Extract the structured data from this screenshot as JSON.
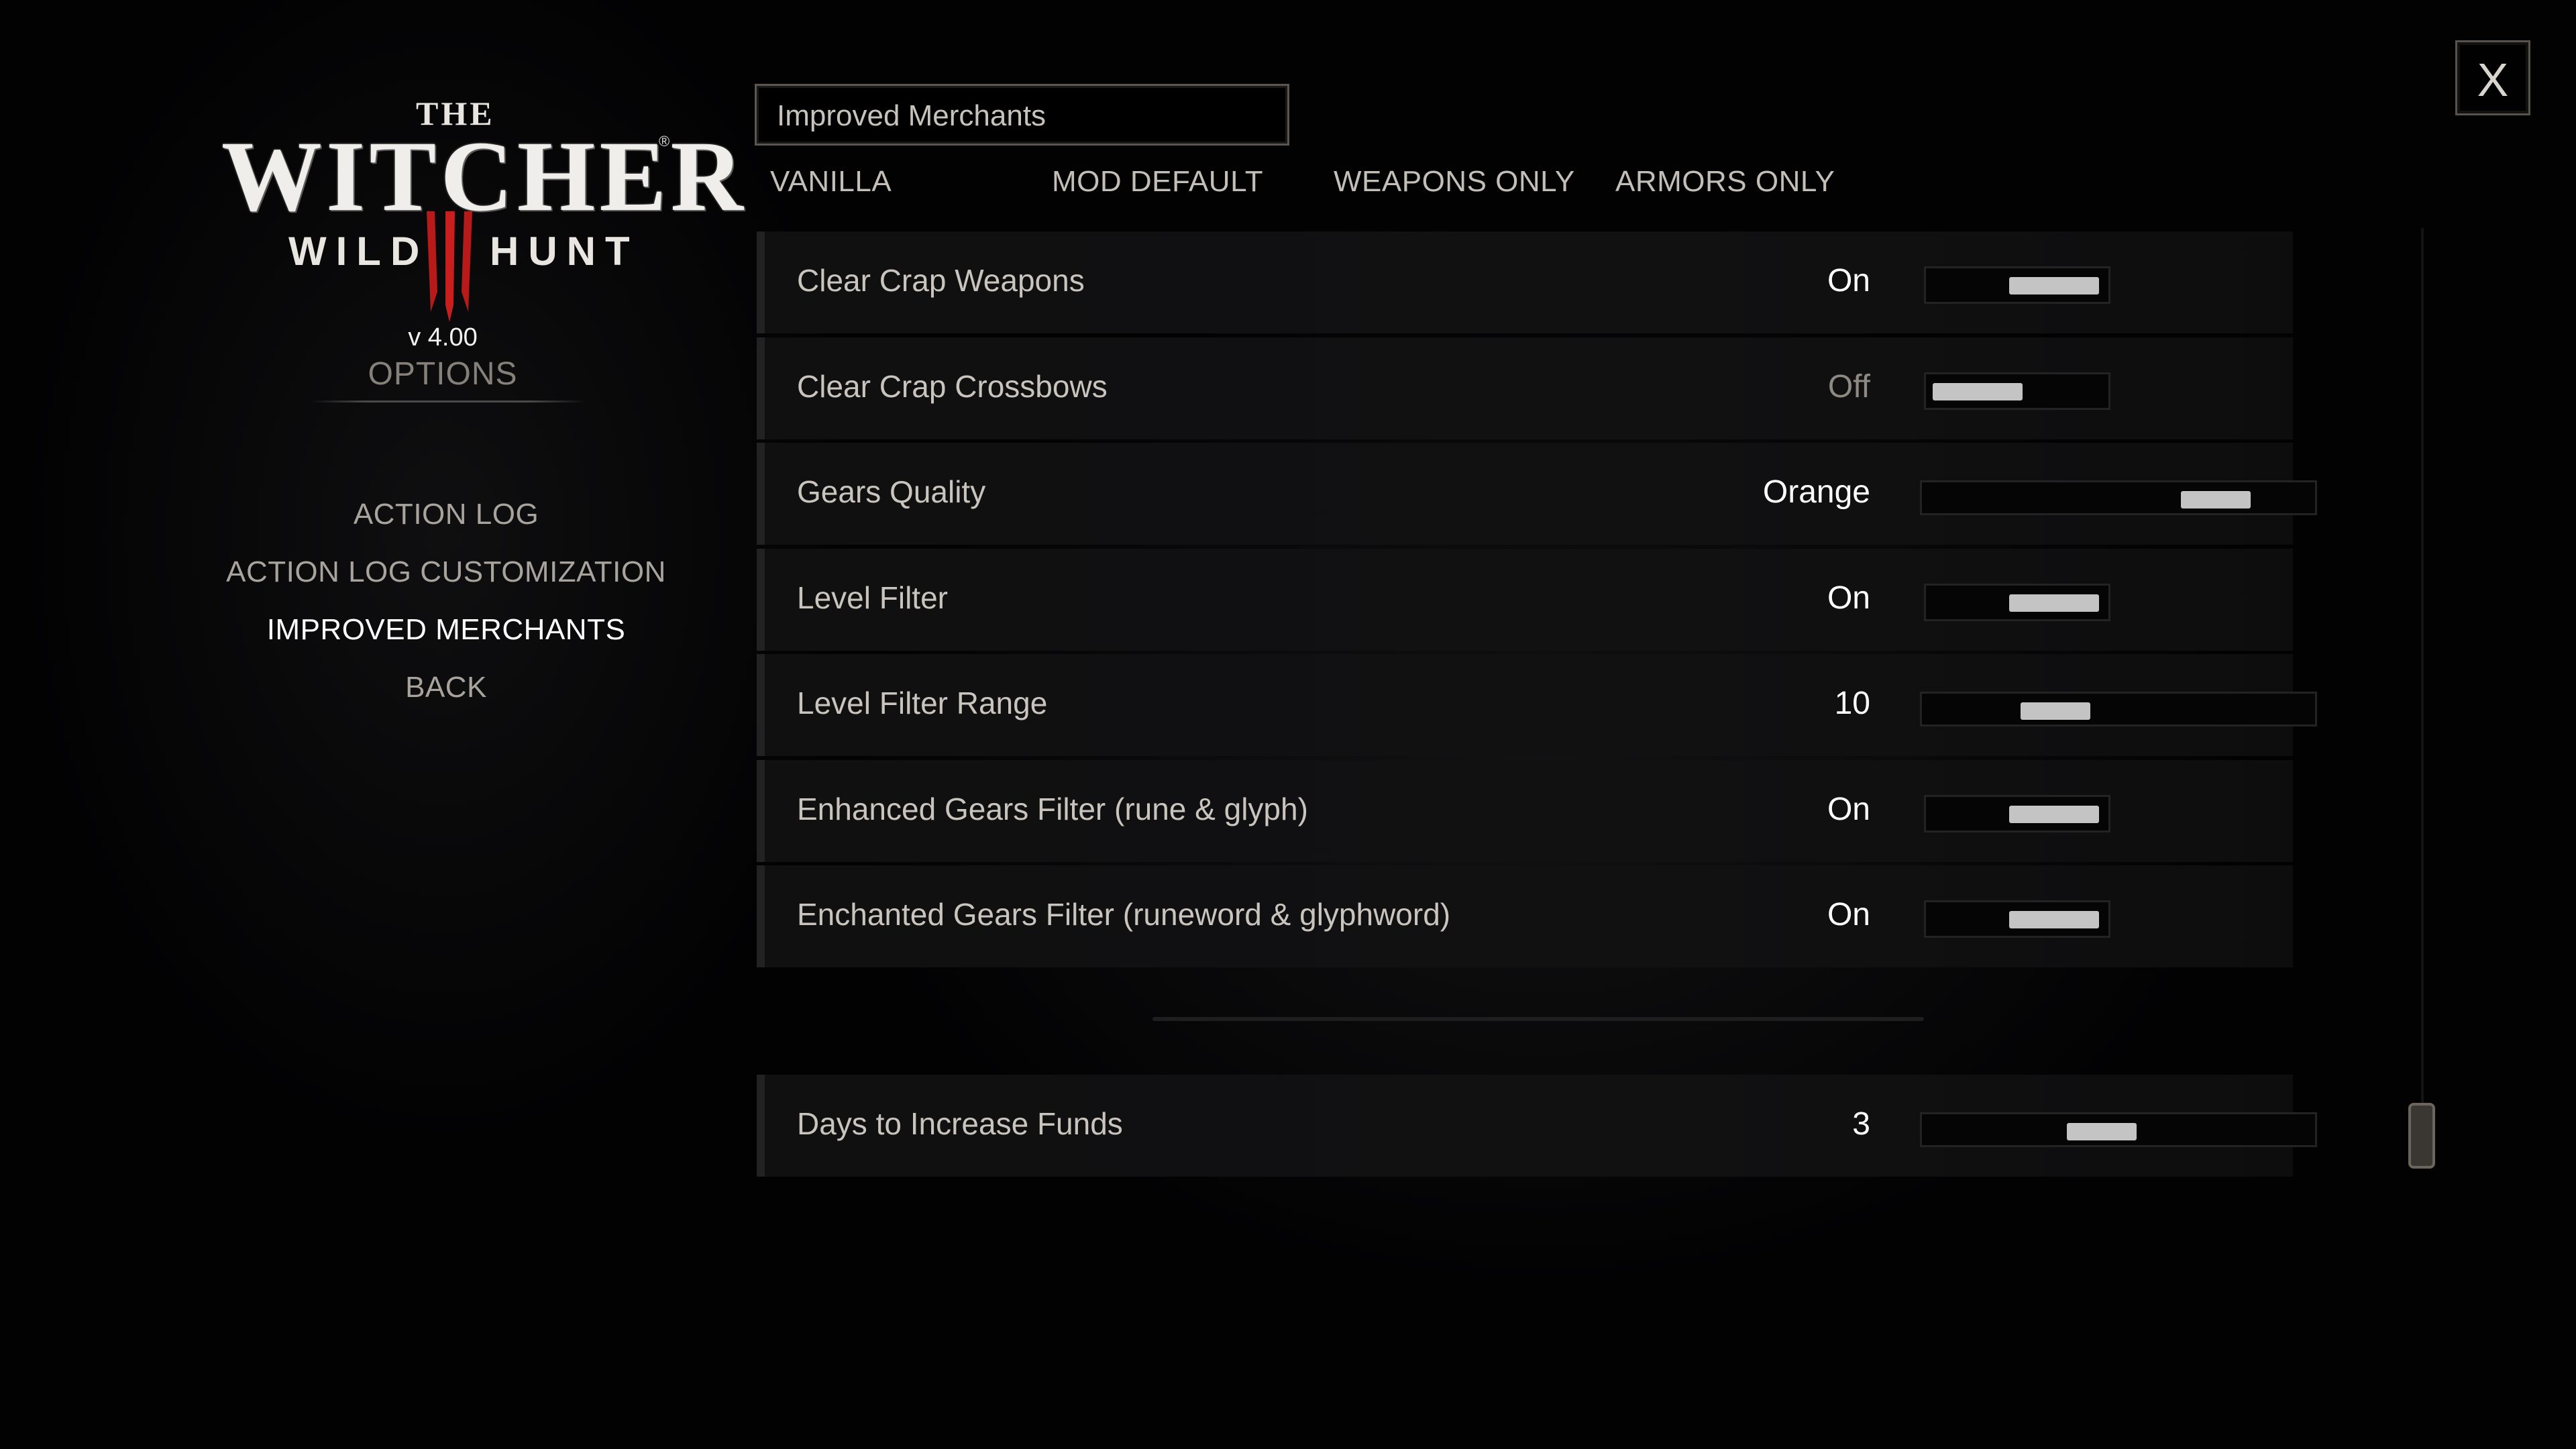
{
  "logo": {
    "the": "THE",
    "witcher": "WITCHER",
    "wild": "WILD",
    "hunt": "HUNT",
    "numeral": "III",
    "reg": "®"
  },
  "version": "v 4.00",
  "options_title": "OPTIONS",
  "nav": [
    {
      "label": "ACTION LOG"
    },
    {
      "label": "ACTION LOG CUSTOMIZATION"
    },
    {
      "label": "IMPROVED MERCHANTS",
      "active": true
    },
    {
      "label": "BACK"
    }
  ],
  "mod_title": "Improved Merchants",
  "presets": [
    "VANILLA",
    "MOD DEFAULT",
    "WEAPONS ONLY",
    "ARMORS ONLY"
  ],
  "options": [
    {
      "label": "Clear Crap Weapons",
      "value": "On",
      "control": "toggle",
      "level": 1
    },
    {
      "label": "Clear Crap Crossbows",
      "value": "Off",
      "control": "toggle",
      "level": 0
    },
    {
      "label": "Gears Quality",
      "value": "Orange",
      "control": "slider",
      "level": 0.82
    },
    {
      "label": "Level Filter",
      "value": "On",
      "control": "toggle",
      "level": 1
    },
    {
      "label": "Level Filter Range",
      "value": "10",
      "control": "slider",
      "level": 0.3
    },
    {
      "label": "Enhanced Gears Filter (rune & glyph)",
      "value": "On",
      "control": "toggle",
      "level": 1
    },
    {
      "label": "Enchanted Gears Filter (runeword & glyphword)",
      "value": "On",
      "control": "toggle",
      "level": 1
    }
  ],
  "options_lower": [
    {
      "label": "Days to Increase Funds",
      "value": "3",
      "control": "slider",
      "level": 0.45
    }
  ],
  "close_label": "X",
  "icons": {
    "close": "close-icon",
    "scroll": "scrollbar-thumb"
  },
  "colors": {
    "background": "#020203",
    "text": "#cfcac2",
    "active": "#ffffff",
    "knob": "#c4c4c4"
  }
}
